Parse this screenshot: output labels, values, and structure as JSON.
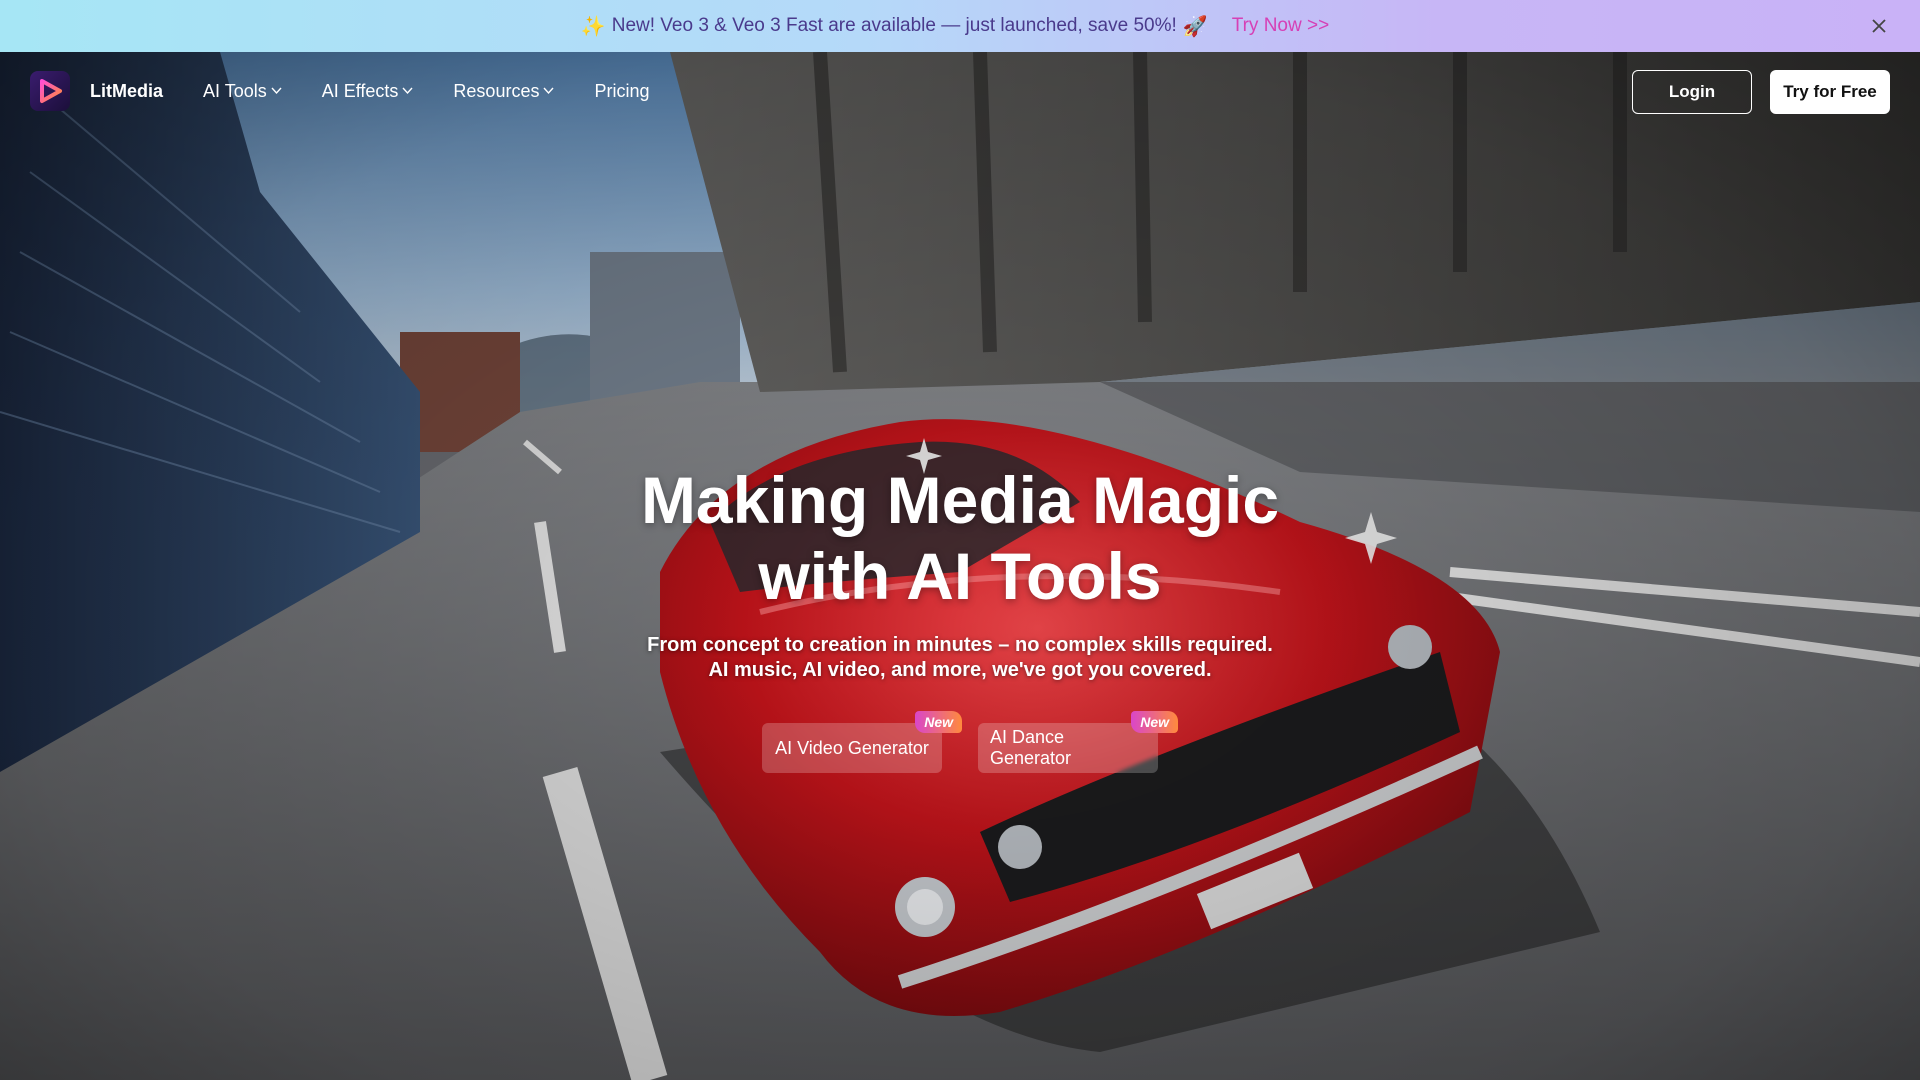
{
  "banner": {
    "message": "New! Veo 3 & Veo 3 Fast are available — just launched, save 50%!",
    "link": "Try Now >>",
    "icons": [
      "sparkle-icon",
      "rocket-icon",
      "close-icon"
    ]
  },
  "nav": {
    "brand": "LitMedia",
    "items": [
      {
        "label": "AI Tools",
        "has_dropdown": true
      },
      {
        "label": "AI Effects",
        "has_dropdown": true
      },
      {
        "label": "Resources",
        "has_dropdown": true
      },
      {
        "label": "Pricing",
        "has_dropdown": false
      }
    ],
    "login": "Login",
    "try_free": "Try for Free"
  },
  "hero": {
    "headline_line1": "Making Media Magic",
    "headline_line2": "with AI Tools",
    "sub_line1": "From concept to creation in minutes – no complex skills required.",
    "sub_line2": "AI music, AI video, and more, we've got you covered.",
    "buttons": [
      {
        "label": "AI Video Generator",
        "badge": "New"
      },
      {
        "label": "AI Dance Generator",
        "badge": "New"
      }
    ]
  },
  "colors": {
    "banner_link": "#d640b6",
    "banner_text": "#4a3a8c",
    "badge_from": "#d946c9",
    "badge_to": "#ff8a3d",
    "car": "#c8141b"
  }
}
